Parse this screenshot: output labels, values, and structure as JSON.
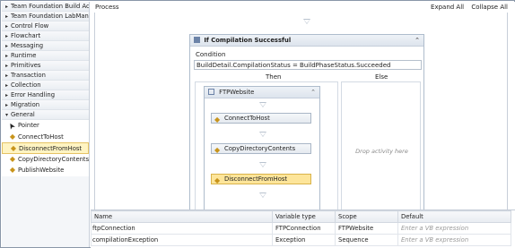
{
  "toolbox": {
    "categories": [
      {
        "label": "Team Foundation Build Activ...",
        "arrow": "▸"
      },
      {
        "label": "Team Foundation LabManag...",
        "arrow": "▸"
      },
      {
        "label": "Control Flow",
        "arrow": "▸"
      },
      {
        "label": "Flowchart",
        "arrow": "▸"
      },
      {
        "label": "Messaging",
        "arrow": "▸"
      },
      {
        "label": "Runtime",
        "arrow": "▸"
      },
      {
        "label": "Primitives",
        "arrow": "▸"
      },
      {
        "label": "Transaction",
        "arrow": "▸"
      },
      {
        "label": "Collection",
        "arrow": "▸"
      },
      {
        "label": "Error Handling",
        "arrow": "▸"
      },
      {
        "label": "Migration",
        "arrow": "▸"
      },
      {
        "label": "General",
        "arrow": "▾"
      }
    ],
    "items": [
      {
        "label": "Pointer",
        "icon": "pointer-icon"
      },
      {
        "label": "ConnectToHost",
        "icon": "activity-icon"
      },
      {
        "label": "DisconnectFromHost",
        "icon": "activity-icon",
        "selected": true
      },
      {
        "label": "CopyDirectoryContents",
        "icon": "activity-icon"
      },
      {
        "label": "PublishWebsite",
        "icon": "activity-icon"
      }
    ]
  },
  "designer": {
    "breadcrumb": "Process",
    "expand_all": "Expand All",
    "collapse_all": "Collapse All"
  },
  "if_activity": {
    "title": "If Compilation Successful",
    "condition_label": "Condition",
    "condition_value": "BuildDetail.CompilationStatus = BuildPhaseStatus.Succeeded",
    "then_label": "Then",
    "else_label": "Else",
    "else_hint": "Drop activity here"
  },
  "sequence": {
    "title": "FTPWebsite",
    "activities": [
      {
        "label": "ConnectToHost"
      },
      {
        "label": "CopyDirectoryContents"
      },
      {
        "label": "DisconnectFromHost",
        "selected": true
      }
    ]
  },
  "variables": {
    "headers": [
      "Name",
      "Variable type",
      "Scope",
      "Default"
    ],
    "rows": [
      {
        "name": "ftpConnection",
        "type": "FTPConnection",
        "scope": "FTPWebsite",
        "default": "Enter a VB expression"
      },
      {
        "name": "compilationException",
        "type": "Exception",
        "scope": "Sequence",
        "default": "Enter a VB expression"
      }
    ]
  },
  "colors": {
    "selection": "#fde59a",
    "activity_icon": "#c8941b",
    "border": "#aebccc"
  }
}
